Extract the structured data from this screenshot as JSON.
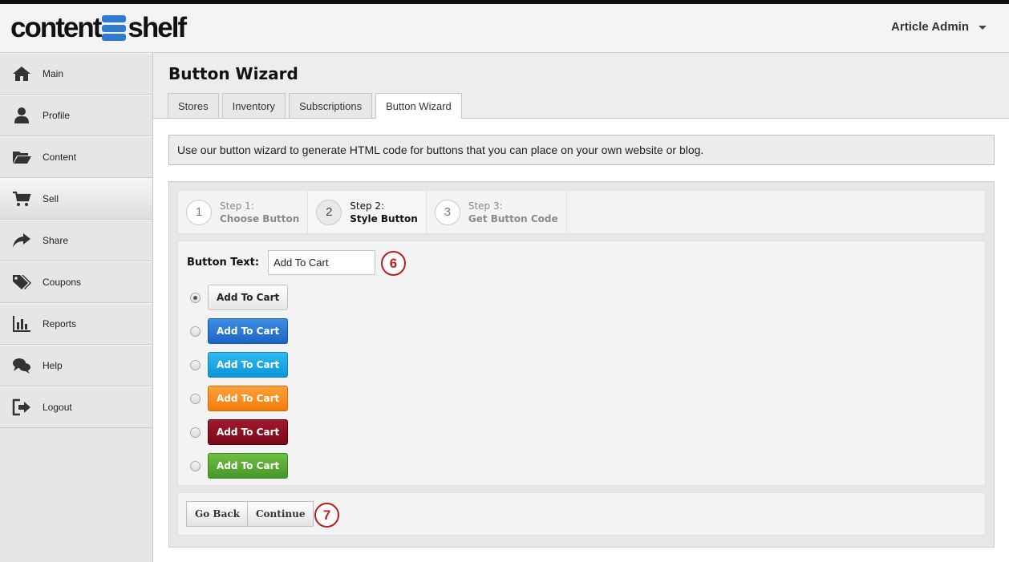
{
  "header": {
    "logo_left": "content",
    "logo_right": "shelf",
    "user_name": "Article Admin"
  },
  "sidebar": {
    "items": [
      {
        "label": "Main",
        "icon": "home-icon"
      },
      {
        "label": "Profile",
        "icon": "user-icon"
      },
      {
        "label": "Content",
        "icon": "folder-icon"
      },
      {
        "label": "Sell",
        "icon": "cart-icon",
        "active": true
      },
      {
        "label": "Share",
        "icon": "share-icon"
      },
      {
        "label": "Coupons",
        "icon": "tags-icon"
      },
      {
        "label": "Reports",
        "icon": "bar-chart-icon"
      },
      {
        "label": "Help",
        "icon": "chat-icon"
      },
      {
        "label": "Logout",
        "icon": "logout-icon"
      }
    ]
  },
  "page": {
    "title": "Button Wizard",
    "tabs": [
      "Stores",
      "Inventory",
      "Subscriptions",
      "Button Wizard"
    ],
    "active_tab": "Button Wizard",
    "info": "Use our button wizard to generate HTML code for buttons that you can place on your own website or blog."
  },
  "wizard": {
    "steps": [
      {
        "num": "1",
        "label": "Step 1:",
        "title": "Choose Button"
      },
      {
        "num": "2",
        "label": "Step 2:",
        "title": "Style Button",
        "current": true
      },
      {
        "num": "3",
        "label": "Step 3:",
        "title": "Get Button Code"
      }
    ],
    "button_text_label": "Button Text:",
    "button_text_value": "Add To Cart",
    "callout_text_field": "6",
    "styles": [
      {
        "label": "Add To Cart",
        "color": "#e6e6e6",
        "checked": true
      },
      {
        "label": "Add To Cart",
        "color": "#1c64c6"
      },
      {
        "label": "Add To Cart",
        "color": "#0b95d6"
      },
      {
        "label": "Add To Cart",
        "color": "#f27b09"
      },
      {
        "label": "Add To Cart",
        "color": "#7a0718"
      },
      {
        "label": "Add To Cart",
        "color": "#46972a"
      }
    ],
    "go_back_label": "Go Back",
    "continue_label": "Continue",
    "callout_actions": "7"
  }
}
